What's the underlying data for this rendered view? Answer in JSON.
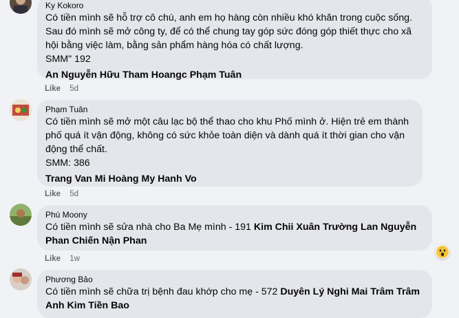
{
  "comments": [
    {
      "author": "Ky Kokoro",
      "text": "Có tiền mình sẽ hỗ trợ cô chú, anh em họ hàng còn nhiều khó khăn trong cuộc sống.\nSau đó mình sẽ mở công ty, để có thể chung tay góp sức đóng góp thiết thực cho xã\nhội bằng việc làm, bằng sản phẩm hàng hóa có chất lượng.\nSMM\" 192",
      "tags": "An Nguyễn Hữu Tham Hoangc Phạm Tuân",
      "like": "Like",
      "time": "5d"
    },
    {
      "author": "Phạm Tuân",
      "text": "Có tiền mình sẽ mở một câu lạc bộ thể thao cho khu Phố mình ở. Hiện trẻ em thành\nphố quá ít vận động, không có sức khỏe toàn diện và dành quá ít thời gian cho vận\nđộng thể chất.\nSMM: 386",
      "tags": "Trang Van Mi Hoàng My Hanh Vo",
      "like": "Like",
      "time": "5d"
    },
    {
      "author": "Phú Moony",
      "text": "Có tiền mình sẽ sửa nhà cho Ba Mẹ mình - 191 ",
      "tags": "Kim Chii Xuân Trường Lan Nguyễn Phan Chiến Nận Phan",
      "like": "Like",
      "time": "1w",
      "reaction": "wow"
    },
    {
      "author": "Phương Bảo",
      "text": "Có tiền mình sẽ chữa trị bệnh đau khớp cho mẹ - 572 ",
      "tags": "Duyên Lý Nghi Mai Trâm Trâm Anh Kim Tiền Bao"
    }
  ]
}
